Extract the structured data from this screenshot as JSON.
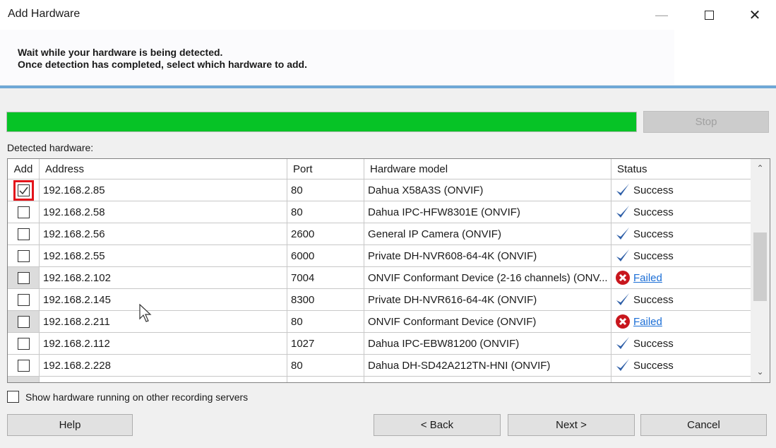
{
  "window": {
    "title": "Add Hardware"
  },
  "header": {
    "line1": "Wait while your hardware is being detected.",
    "line2": "Once detection has completed, select which hardware to add."
  },
  "progress": {
    "percent": 100,
    "color": "#06c326"
  },
  "stop_label": "Stop",
  "detected_label": "Detected hardware:",
  "columns": [
    "Add",
    "Address",
    "Port",
    "Hardware model",
    "Status"
  ],
  "rows": [
    {
      "checked": true,
      "address": "192.168.2.85",
      "port": "80",
      "model": "Dahua X58A3S (ONVIF)",
      "status": "Success"
    },
    {
      "checked": false,
      "address": "192.168.2.58",
      "port": "80",
      "model": "Dahua IPC-HFW8301E (ONVIF)",
      "status": "Success"
    },
    {
      "checked": false,
      "address": "192.168.2.56",
      "port": "2600",
      "model": "General IP Camera (ONVIF)",
      "status": "Success"
    },
    {
      "checked": false,
      "address": "192.168.2.55",
      "port": "6000",
      "model": "Private DH-NVR608-64-4K (ONVIF)",
      "status": "Success"
    },
    {
      "checked": false,
      "address": "192.168.2.102",
      "port": "7004",
      "model": "ONVIF Conformant Device (2-16 channels) (ONV...",
      "status": "Failed"
    },
    {
      "checked": false,
      "address": "192.168.2.145",
      "port": "8300",
      "model": "Private DH-NVR616-64-4K (ONVIF)",
      "status": "Success"
    },
    {
      "checked": false,
      "address": "192.168.2.211",
      "port": "80",
      "model": "ONVIF Conformant Device (ONVIF)",
      "status": "Failed"
    },
    {
      "checked": false,
      "address": "192.168.2.112",
      "port": "1027",
      "model": "Dahua IPC-EBW81200 (ONVIF)",
      "status": "Success"
    },
    {
      "checked": false,
      "address": "192.168.2.228",
      "port": "80",
      "model": "Dahua DH-SD42A212TN-HNI (ONVIF)",
      "status": "Success"
    }
  ],
  "show_other_label": "Show hardware running on other recording servers",
  "buttons": {
    "help": "Help",
    "back": "< Back",
    "next": "Next >",
    "cancel": "Cancel"
  }
}
